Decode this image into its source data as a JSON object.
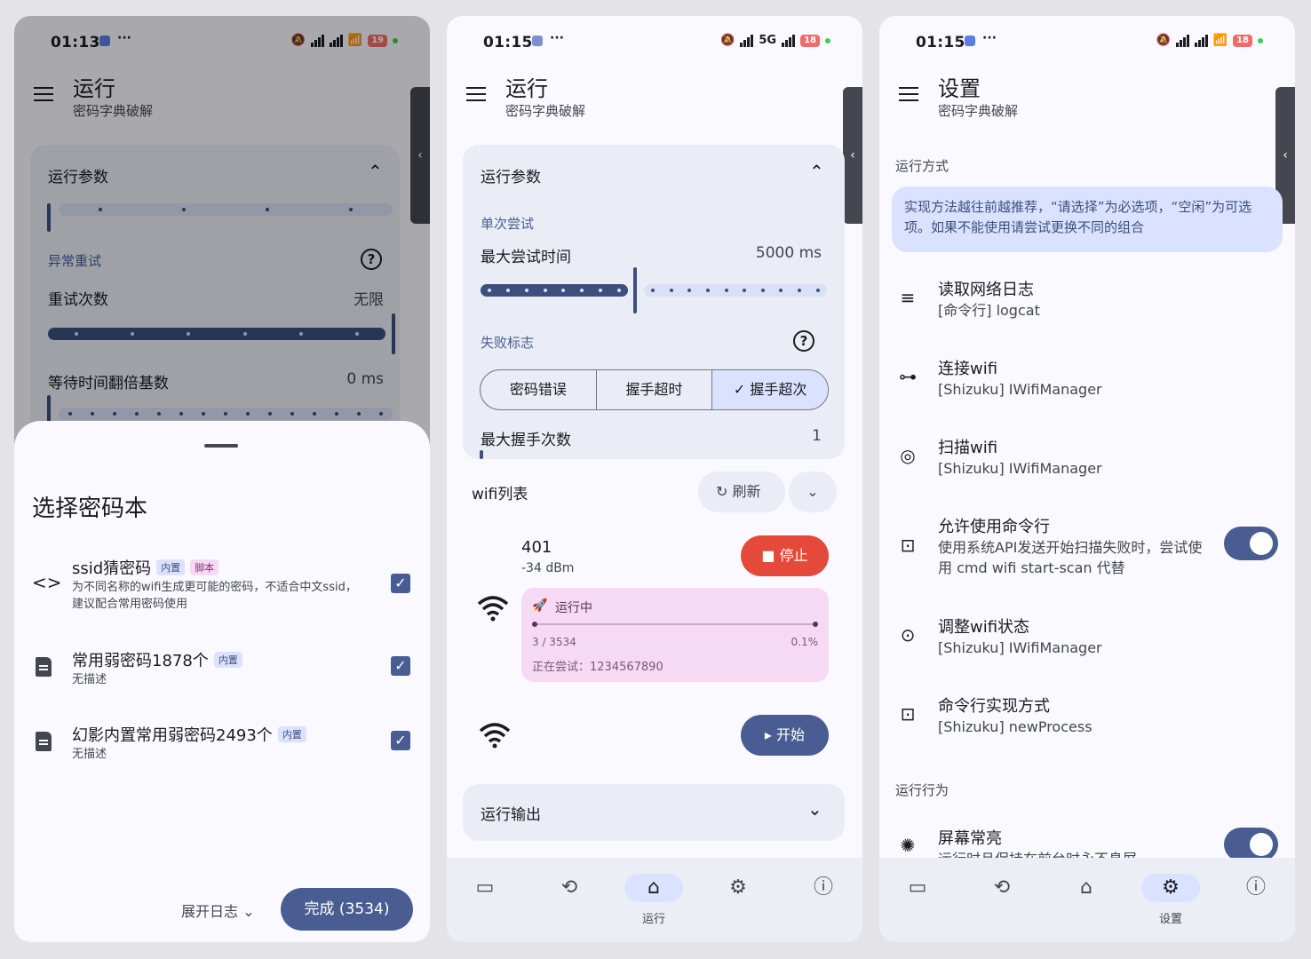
{
  "screens": [
    {
      "status": {
        "time": "01:13",
        "battery": "19"
      },
      "header": {
        "title": "运行",
        "subtitle": "密码字典破解"
      },
      "params": {
        "title": "运行参数",
        "retry_section": "异常重试",
        "retry_count_label": "重试次数",
        "retry_count_value": "无限",
        "wait_label": "等待时间翻倍基数",
        "wait_value": "0 ms"
      },
      "sheet": {
        "title": "选择密码本",
        "items": [
          {
            "title": "ssid猜密码",
            "tags": [
              "内置",
              "脚本"
            ],
            "desc": "为不同名称的wifi生成更可能的密码，不适合中文ssid，建议配合常用密码使用",
            "checked": true
          },
          {
            "title": "常用弱密码1878个",
            "tags": [
              "内置"
            ],
            "desc": "无描述",
            "checked": true
          },
          {
            "title": "幻影内置常用弱密码2493个",
            "tags": [
              "内置"
            ],
            "desc": "无描述",
            "checked": true
          }
        ],
        "expand_log": "展开日志",
        "done_button": "完成 (3534)"
      }
    },
    {
      "status": {
        "time": "01:15",
        "battery": "18",
        "network": "5G"
      },
      "header": {
        "title": "运行",
        "subtitle": "密码字典破解"
      },
      "params": {
        "title": "运行参数",
        "single_try": "单次尝试",
        "max_time_label": "最大尝试时间",
        "max_time_value": "5000 ms",
        "max_time_fraction": 0.42,
        "fail_flag": "失败标志",
        "segments": [
          "密码错误",
          "握手超时",
          "握手超次"
        ],
        "selected_segment": "握手超次",
        "max_handshake_label": "最大握手次数",
        "max_handshake_value": "1"
      },
      "wifi_list": {
        "title": "wifi列表",
        "refresh": "刷新",
        "networks": [
          {
            "name": "401",
            "signal": "-34 dBm",
            "action": "停止",
            "status": "运行中",
            "progress_text": "3 / 3534",
            "percent": "0.1%",
            "trying": "正在尝试：1234567890",
            "progress_fraction": 0.001
          },
          {
            "action": "开始"
          }
        ]
      },
      "output": {
        "title": "运行输出"
      },
      "nav": {
        "active_label": "运行"
      }
    },
    {
      "status": {
        "time": "01:15",
        "battery": "18"
      },
      "header": {
        "title": "设置",
        "subtitle": "密码字典破解"
      },
      "run_mode": {
        "section": "运行方式",
        "info": "实现方法越往前越推荐，“请选择”为必选项，“空闲”为可选项。如果不能使用请尝试更换不同的组合",
        "items": [
          {
            "icon": "search-list-icon",
            "title": "读取网络日志",
            "desc": "[命令行] logcat"
          },
          {
            "icon": "link-icon",
            "title": "连接wifi",
            "desc": "[Shizuku] IWifiManager"
          },
          {
            "icon": "scan-icon",
            "title": "扫描wifi",
            "desc": "[Shizuku] IWifiManager"
          },
          {
            "icon": "terminal-icon",
            "title": "允许使用命令行",
            "desc": "使用系统API发送开始扫描失败时，尝试使用 cmd wifi start-scan 代替",
            "toggle": true
          },
          {
            "icon": "toggle-icon",
            "title": "调整wifi状态",
            "desc": "[Shizuku] IWifiManager"
          },
          {
            "icon": "terminal-icon",
            "title": "命令行实现方式",
            "desc": "[Shizuku] newProcess"
          }
        ]
      },
      "run_behavior": {
        "section": "运行行为",
        "items": [
          {
            "icon": "brightness-icon",
            "title": "屏幕常亮",
            "desc": "运行时且保持在前台时永不息屏",
            "toggle": true
          }
        ]
      },
      "nav": {
        "active_label": "设置"
      }
    }
  ]
}
